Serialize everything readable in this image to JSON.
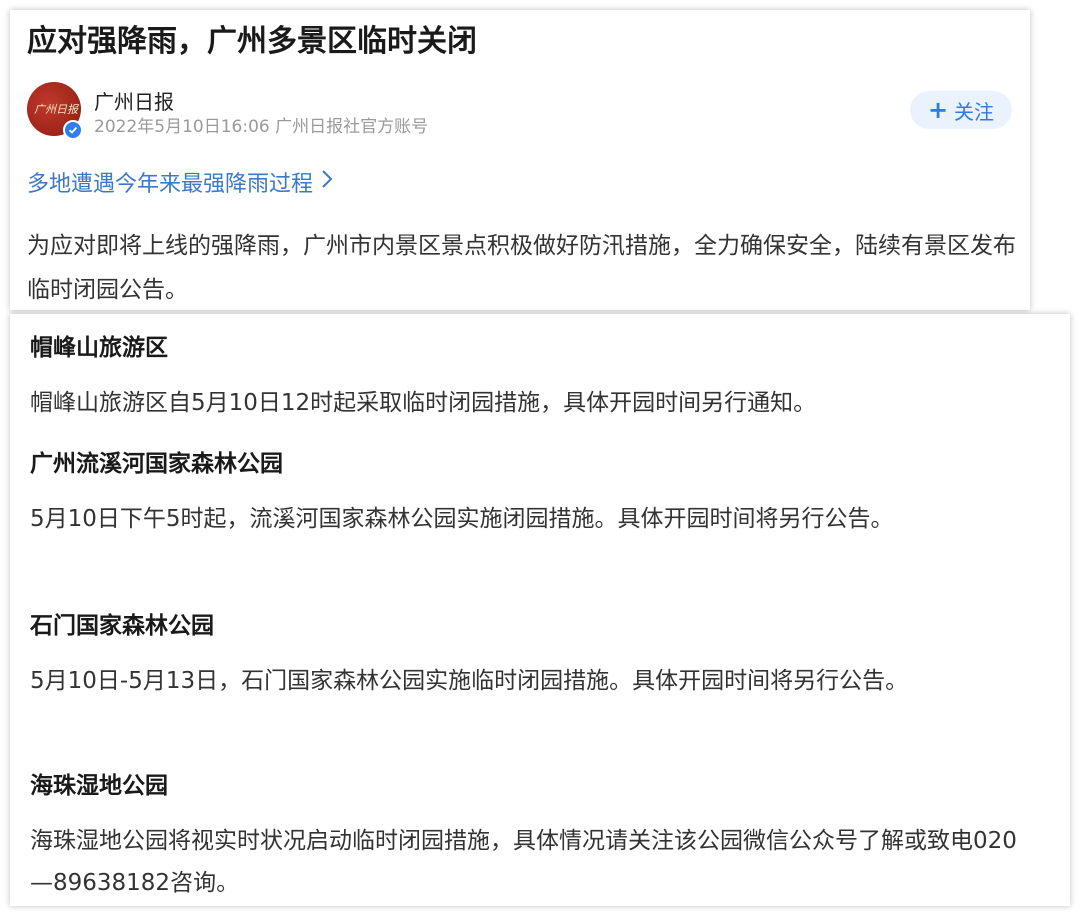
{
  "article": {
    "title": "应对强降雨，广州多景区临时关闭",
    "author": {
      "avatar_text": "广州日报",
      "name": "广州日报",
      "meta": "2022年5月10日16:06 广州日报社官方账号"
    },
    "follow_button": {
      "icon": "plus-icon",
      "label": "关注"
    },
    "topic_link": {
      "text": "多地遭遇今年来最强降雨过程",
      "icon": "chevron-right-icon"
    },
    "intro": "为应对即将上线的强降雨，广州市内景区景点积极做好防汛措施，全力确保安全，陆续有景区发布临时闭园公告。",
    "sections": [
      {
        "heading": "帽峰山旅游区",
        "body": "帽峰山旅游区自5月10日12时起采取临时闭园措施，具体开园时间另行通知。"
      },
      {
        "heading": "广州流溪河国家森林公园",
        "body": "5月10日下午5时起，流溪河国家森林公园实施闭园措施。具体开园时间将另行公告。"
      },
      {
        "heading": "石门国家森林公园",
        "body": "5月10日-5月13日，石门国家森林公园实施临时闭园措施。具体开园时间将另行公告。"
      },
      {
        "heading": "海珠湿地公园",
        "body": "海珠湿地公园将视实时状况启动临时闭园措施，具体情况请关注该公园微信公众号了解或致电020—89638182咨询。"
      }
    ]
  },
  "colors": {
    "link": "#3d78c7",
    "follow_text": "#2d7be5",
    "follow_bg": "#eaf3fd",
    "meta": "#9a9a9a",
    "avatar": "#a52a1e"
  }
}
